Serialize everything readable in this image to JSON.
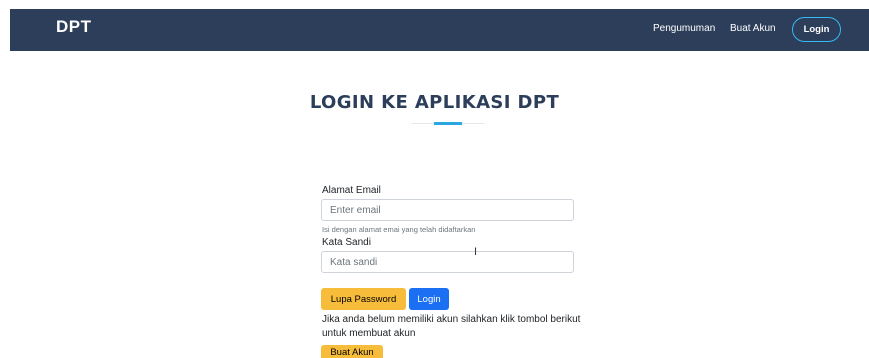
{
  "navbar": {
    "brand": "DPT",
    "links": [
      {
        "label": "Pengumuman"
      },
      {
        "label": "Buat Akun"
      }
    ],
    "login_button": "Login"
  },
  "main": {
    "title": "LOGIN KE APLIKASI DPT",
    "form": {
      "email_label": "Alamat Email",
      "email_placeholder": "Enter email",
      "email_help": "Isi dengan alamat emai yang telah didaftarkan",
      "password_label": "Kata Sandi",
      "password_placeholder": "Kata sandi"
    },
    "buttons": {
      "forgot_password": "Lupa Password",
      "login": "Login"
    },
    "register_info": "Jika anda belum memiliki akun silahkan klik tombol berikut untuk membuat akun",
    "register_button": "Buat Akun"
  },
  "colors": {
    "navbar_bg": "#2c3e5a",
    "accent_blue": "#2aa7e0",
    "warning": "#f7bd3a",
    "primary": "#1a6ff2"
  }
}
